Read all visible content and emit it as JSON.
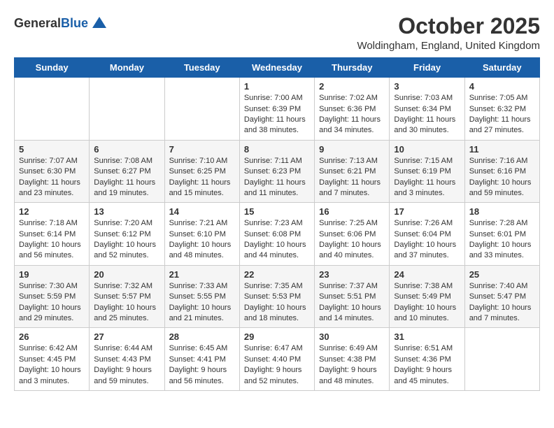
{
  "logo": {
    "general": "General",
    "blue": "Blue"
  },
  "header": {
    "month": "October 2025",
    "location": "Woldingham, England, United Kingdom"
  },
  "weekdays": [
    "Sunday",
    "Monday",
    "Tuesday",
    "Wednesday",
    "Thursday",
    "Friday",
    "Saturday"
  ],
  "weeks": [
    [
      {
        "day": "",
        "info": ""
      },
      {
        "day": "",
        "info": ""
      },
      {
        "day": "",
        "info": ""
      },
      {
        "day": "1",
        "info": "Sunrise: 7:00 AM\nSunset: 6:39 PM\nDaylight: 11 hours\nand 38 minutes."
      },
      {
        "day": "2",
        "info": "Sunrise: 7:02 AM\nSunset: 6:36 PM\nDaylight: 11 hours\nand 34 minutes."
      },
      {
        "day": "3",
        "info": "Sunrise: 7:03 AM\nSunset: 6:34 PM\nDaylight: 11 hours\nand 30 minutes."
      },
      {
        "day": "4",
        "info": "Sunrise: 7:05 AM\nSunset: 6:32 PM\nDaylight: 11 hours\nand 27 minutes."
      }
    ],
    [
      {
        "day": "5",
        "info": "Sunrise: 7:07 AM\nSunset: 6:30 PM\nDaylight: 11 hours\nand 23 minutes."
      },
      {
        "day": "6",
        "info": "Sunrise: 7:08 AM\nSunset: 6:27 PM\nDaylight: 11 hours\nand 19 minutes."
      },
      {
        "day": "7",
        "info": "Sunrise: 7:10 AM\nSunset: 6:25 PM\nDaylight: 11 hours\nand 15 minutes."
      },
      {
        "day": "8",
        "info": "Sunrise: 7:11 AM\nSunset: 6:23 PM\nDaylight: 11 hours\nand 11 minutes."
      },
      {
        "day": "9",
        "info": "Sunrise: 7:13 AM\nSunset: 6:21 PM\nDaylight: 11 hours\nand 7 minutes."
      },
      {
        "day": "10",
        "info": "Sunrise: 7:15 AM\nSunset: 6:19 PM\nDaylight: 11 hours\nand 3 minutes."
      },
      {
        "day": "11",
        "info": "Sunrise: 7:16 AM\nSunset: 6:16 PM\nDaylight: 10 hours\nand 59 minutes."
      }
    ],
    [
      {
        "day": "12",
        "info": "Sunrise: 7:18 AM\nSunset: 6:14 PM\nDaylight: 10 hours\nand 56 minutes."
      },
      {
        "day": "13",
        "info": "Sunrise: 7:20 AM\nSunset: 6:12 PM\nDaylight: 10 hours\nand 52 minutes."
      },
      {
        "day": "14",
        "info": "Sunrise: 7:21 AM\nSunset: 6:10 PM\nDaylight: 10 hours\nand 48 minutes."
      },
      {
        "day": "15",
        "info": "Sunrise: 7:23 AM\nSunset: 6:08 PM\nDaylight: 10 hours\nand 44 minutes."
      },
      {
        "day": "16",
        "info": "Sunrise: 7:25 AM\nSunset: 6:06 PM\nDaylight: 10 hours\nand 40 minutes."
      },
      {
        "day": "17",
        "info": "Sunrise: 7:26 AM\nSunset: 6:04 PM\nDaylight: 10 hours\nand 37 minutes."
      },
      {
        "day": "18",
        "info": "Sunrise: 7:28 AM\nSunset: 6:01 PM\nDaylight: 10 hours\nand 33 minutes."
      }
    ],
    [
      {
        "day": "19",
        "info": "Sunrise: 7:30 AM\nSunset: 5:59 PM\nDaylight: 10 hours\nand 29 minutes."
      },
      {
        "day": "20",
        "info": "Sunrise: 7:32 AM\nSunset: 5:57 PM\nDaylight: 10 hours\nand 25 minutes."
      },
      {
        "day": "21",
        "info": "Sunrise: 7:33 AM\nSunset: 5:55 PM\nDaylight: 10 hours\nand 21 minutes."
      },
      {
        "day": "22",
        "info": "Sunrise: 7:35 AM\nSunset: 5:53 PM\nDaylight: 10 hours\nand 18 minutes."
      },
      {
        "day": "23",
        "info": "Sunrise: 7:37 AM\nSunset: 5:51 PM\nDaylight: 10 hours\nand 14 minutes."
      },
      {
        "day": "24",
        "info": "Sunrise: 7:38 AM\nSunset: 5:49 PM\nDaylight: 10 hours\nand 10 minutes."
      },
      {
        "day": "25",
        "info": "Sunrise: 7:40 AM\nSunset: 5:47 PM\nDaylight: 10 hours\nand 7 minutes."
      }
    ],
    [
      {
        "day": "26",
        "info": "Sunrise: 6:42 AM\nSunset: 4:45 PM\nDaylight: 10 hours\nand 3 minutes."
      },
      {
        "day": "27",
        "info": "Sunrise: 6:44 AM\nSunset: 4:43 PM\nDaylight: 9 hours\nand 59 minutes."
      },
      {
        "day": "28",
        "info": "Sunrise: 6:45 AM\nSunset: 4:41 PM\nDaylight: 9 hours\nand 56 minutes."
      },
      {
        "day": "29",
        "info": "Sunrise: 6:47 AM\nSunset: 4:40 PM\nDaylight: 9 hours\nand 52 minutes."
      },
      {
        "day": "30",
        "info": "Sunrise: 6:49 AM\nSunset: 4:38 PM\nDaylight: 9 hours\nand 48 minutes."
      },
      {
        "day": "31",
        "info": "Sunrise: 6:51 AM\nSunset: 4:36 PM\nDaylight: 9 hours\nand 45 minutes."
      },
      {
        "day": "",
        "info": ""
      }
    ]
  ]
}
